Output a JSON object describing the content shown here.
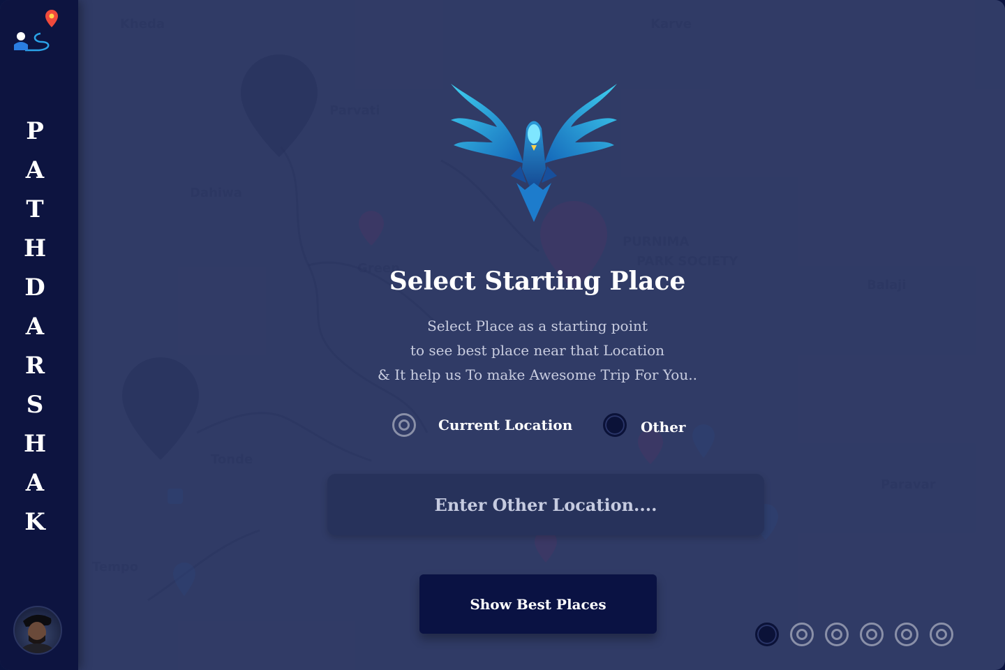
{
  "brand": {
    "letters": [
      "P",
      "A",
      "T",
      "H",
      "D",
      "A",
      "R",
      "S",
      "H",
      "A",
      "K"
    ]
  },
  "main": {
    "title": "Select Starting Place",
    "description": [
      "Select Place as a starting point",
      "to see best place near that Location",
      "& It help us To make Awesome Trip For You.."
    ],
    "options": {
      "current_label": "Current Location",
      "other_label": "Other",
      "selected": "other"
    },
    "location_input": {
      "placeholder": "Enter Other Location....",
      "value": ""
    },
    "show_button_label": "Show Best Places"
  },
  "pagination": {
    "total": 6,
    "active_index": 0
  },
  "colors": {
    "sidebar": "#0d1440",
    "background": "#2f3a63",
    "button": "#0a1243",
    "accent": "#29a6d8"
  },
  "icons": [
    "app-logo-icon",
    "bird-logo-icon",
    "radio-target-icon",
    "radio-filled-icon"
  ]
}
